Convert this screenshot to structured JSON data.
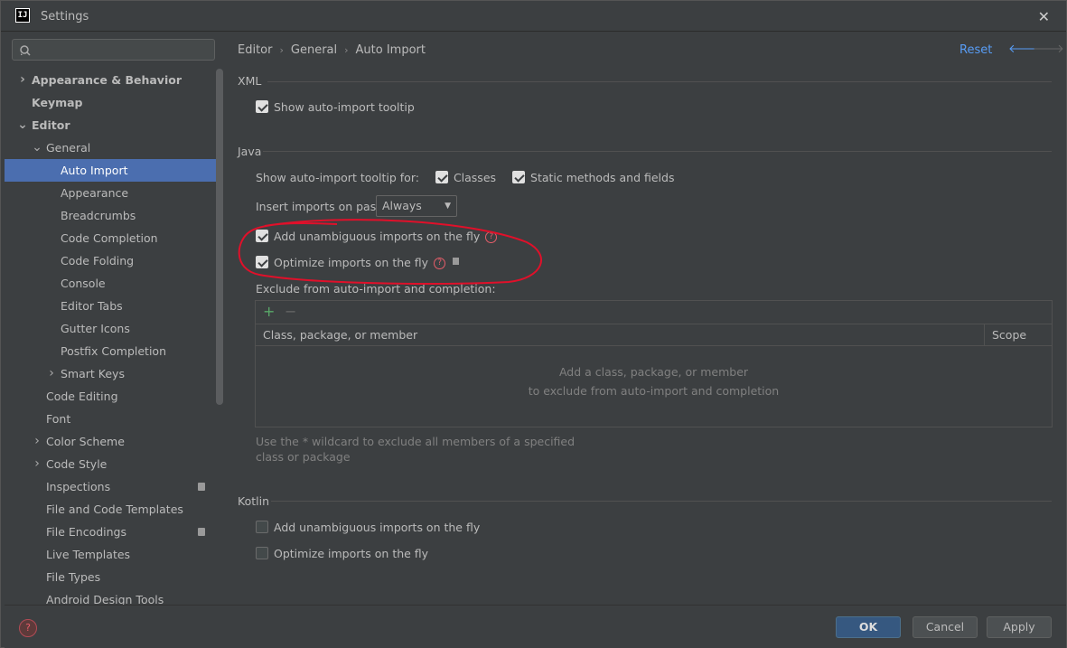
{
  "window": {
    "app_icon_text": "IJ",
    "title": "Settings",
    "close_glyph": "✕"
  },
  "search": {
    "placeholder": ""
  },
  "tree": [
    {
      "label": "Appearance & Behavior",
      "chev": "›",
      "bold": true,
      "level": 0
    },
    {
      "label": "Keymap",
      "chev": "",
      "bold": true,
      "level": 0
    },
    {
      "label": "Editor",
      "chev": "⌄",
      "bold": true,
      "level": 0
    },
    {
      "label": "General",
      "chev": "⌄",
      "bold": false,
      "level": 1
    },
    {
      "label": "Auto Import",
      "chev": "",
      "bold": false,
      "level": 2,
      "selected": true
    },
    {
      "label": "Appearance",
      "chev": "",
      "bold": false,
      "level": 2
    },
    {
      "label": "Breadcrumbs",
      "chev": "",
      "bold": false,
      "level": 2
    },
    {
      "label": "Code Completion",
      "chev": "",
      "bold": false,
      "level": 2
    },
    {
      "label": "Code Folding",
      "chev": "",
      "bold": false,
      "level": 2
    },
    {
      "label": "Console",
      "chev": "",
      "bold": false,
      "level": 2
    },
    {
      "label": "Editor Tabs",
      "chev": "",
      "bold": false,
      "level": 2
    },
    {
      "label": "Gutter Icons",
      "chev": "",
      "bold": false,
      "level": 2
    },
    {
      "label": "Postfix Completion",
      "chev": "",
      "bold": false,
      "level": 2
    },
    {
      "label": "Smart Keys",
      "chev": "›",
      "bold": false,
      "level": 2
    },
    {
      "label": "Code Editing",
      "chev": "",
      "bold": false,
      "level": 1
    },
    {
      "label": "Font",
      "chev": "",
      "bold": false,
      "level": 1
    },
    {
      "label": "Color Scheme",
      "chev": "›",
      "bold": false,
      "level": 1
    },
    {
      "label": "Code Style",
      "chev": "›",
      "bold": false,
      "level": 1
    },
    {
      "label": "Inspections",
      "chev": "",
      "bold": false,
      "level": 1,
      "badge": true
    },
    {
      "label": "File and Code Templates",
      "chev": "",
      "bold": false,
      "level": 1
    },
    {
      "label": "File Encodings",
      "chev": "",
      "bold": false,
      "level": 1,
      "badge": true
    },
    {
      "label": "Live Templates",
      "chev": "",
      "bold": false,
      "level": 1
    },
    {
      "label": "File Types",
      "chev": "",
      "bold": false,
      "level": 1
    },
    {
      "label": "Android Design Tools",
      "chev": "",
      "bold": false,
      "level": 1
    }
  ],
  "breadcrumb": {
    "part1": "Editor",
    "part2": "General",
    "part3": "Auto Import",
    "sep": "›"
  },
  "header": {
    "reset": "Reset",
    "back": "🡐",
    "forward": "🡒"
  },
  "xml": {
    "title": "XML",
    "show_tooltip": {
      "label": "Show auto-import tooltip",
      "checked": true
    }
  },
  "java": {
    "title": "Java",
    "tooltip_for_label": "Show auto-import tooltip for:",
    "classes": {
      "label": "Classes",
      "checked": true
    },
    "static": {
      "label": "Static methods and fields",
      "checked": true
    },
    "paste_label": "Insert imports on paste:",
    "paste_value": "Always",
    "add_unambiguous": {
      "label": "Add unambiguous imports on the fly",
      "checked": true
    },
    "optimize": {
      "label": "Optimize imports on the fly",
      "checked": true
    },
    "exclude_label": "Exclude from auto-import and completion:",
    "table": {
      "add": "+",
      "remove": "−",
      "col_class": "Class, package, or member",
      "col_scope": "Scope",
      "empty_line1": "Add a class, package, or member",
      "empty_line2": "to exclude from auto-import and completion"
    },
    "hint": "Use the * wildcard to exclude all members of a specified class or package"
  },
  "kotlin": {
    "title": "Kotlin",
    "add_unambiguous": {
      "label": "Add unambiguous imports on the fly",
      "checked": false
    },
    "optimize": {
      "label": "Optimize imports on the fly",
      "checked": false
    }
  },
  "footer": {
    "help": "?",
    "ok": "OK",
    "cancel": "Cancel",
    "apply": "Apply"
  },
  "colors": {
    "accent": "#4b6eaf",
    "link": "#589df6",
    "annotation": "#e0102a"
  }
}
